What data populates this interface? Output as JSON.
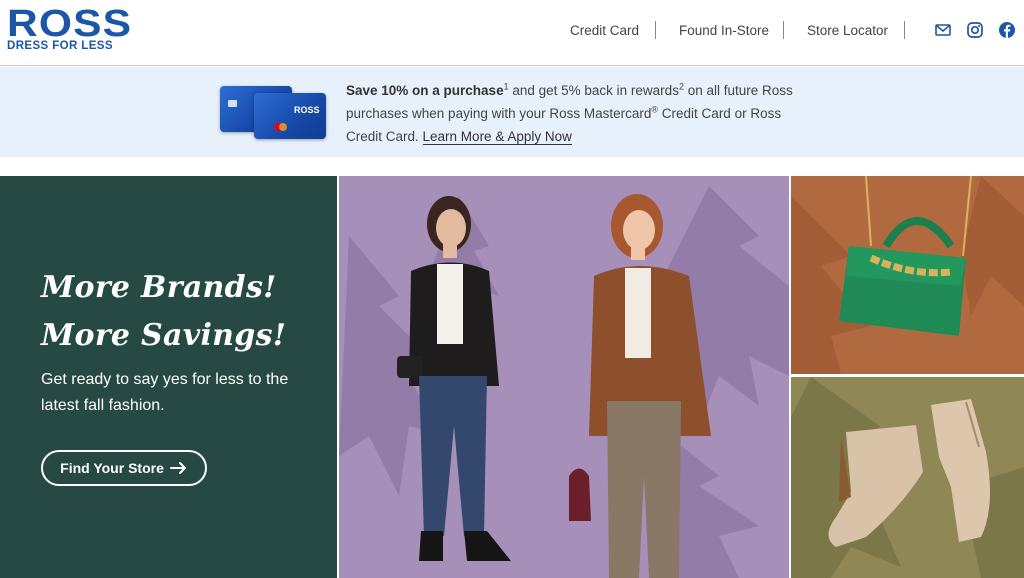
{
  "brand": {
    "name": "ROSS",
    "tagline": "DRESS FOR LESS",
    "color": "#1c56a6"
  },
  "nav": {
    "links": [
      "Credit Card",
      "Found In-Store",
      "Store Locator"
    ],
    "icons": [
      "mail-icon",
      "instagram-icon",
      "facebook-icon"
    ]
  },
  "promo": {
    "bold": "Save 10% on a purchase",
    "sup1": "1",
    "mid": " and get 5% back in rewards",
    "sup2": "2",
    "rest1": " on all future Ross purchases when paying with your Ross Mastercard",
    "reg": "®",
    "rest2": " Credit Card or Ross Credit Card. ",
    "link": "Learn More & Apply Now",
    "card_label": "ROSS",
    "background": "#e7f1fb"
  },
  "hero": {
    "headline_line1": "More Brands!",
    "headline_line2": "More Savings!",
    "subtext": "Get ready to say yes for less to the latest fall fashion.",
    "cta_label": "Find Your Store",
    "cta_icon": "arrow-right-icon",
    "colors": {
      "panel": "#264a43",
      "main": "#a68fb8",
      "top_right": "#b16a3f",
      "bottom_right": "#8f8755"
    }
  }
}
